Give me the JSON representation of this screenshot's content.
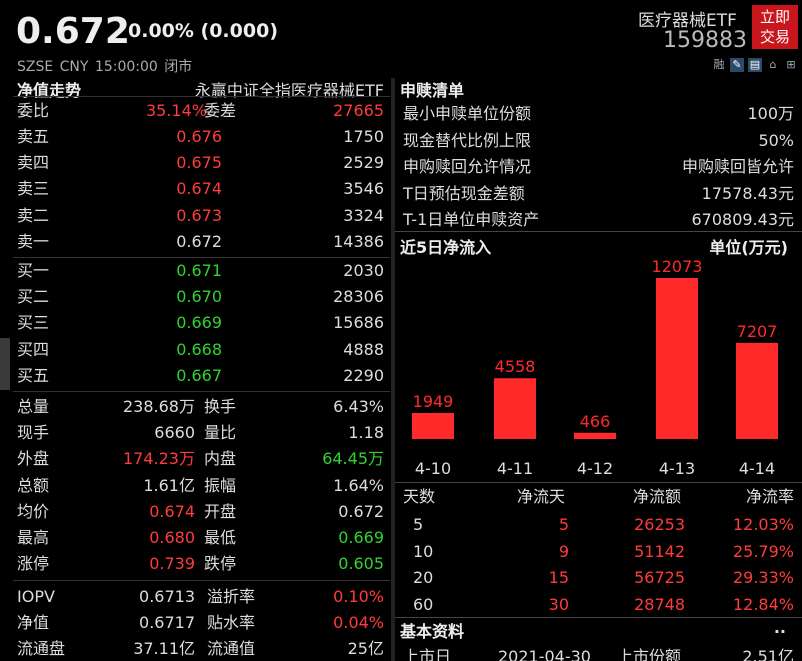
{
  "header": {
    "price": "0.672",
    "change": "0.00% (0.000)",
    "meta": "SZSE  CNY  15:00:00  闭市",
    "name": "医疗器械ETF",
    "code": "159883",
    "trade_button": "立即\n交易",
    "trade_line1": "立即",
    "trade_line2": "交易",
    "tool_icons": [
      "融",
      "pen-icon",
      "doc-icon",
      "home-icon",
      "plus-icon"
    ],
    "tool_label": "融"
  },
  "left": {
    "title": "净值走势",
    "fund_name": "永赢中证全指医疗器械ETF",
    "wei": {
      "label1": "委比",
      "val1": "35.14%",
      "label2": "委差",
      "val2": "27665"
    },
    "asks": [
      {
        "label": "卖五",
        "price": "0.676",
        "vol": "1750"
      },
      {
        "label": "卖四",
        "price": "0.675",
        "vol": "2529"
      },
      {
        "label": "卖三",
        "price": "0.674",
        "vol": "3546"
      },
      {
        "label": "卖二",
        "price": "0.673",
        "vol": "3324"
      },
      {
        "label": "卖一",
        "price": "0.672",
        "vol": "14386"
      }
    ],
    "bids": [
      {
        "label": "买一",
        "price": "0.671",
        "vol": "2030"
      },
      {
        "label": "买二",
        "price": "0.670",
        "vol": "28306"
      },
      {
        "label": "买三",
        "price": "0.669",
        "vol": "15686"
      },
      {
        "label": "买四",
        "price": "0.668",
        "vol": "4888"
      },
      {
        "label": "买五",
        "price": "0.667",
        "vol": "2290"
      }
    ],
    "stats": [
      {
        "l1": "总量",
        "v1": "238.68万",
        "c1": "wht",
        "l2": "换手",
        "v2": "6.43%",
        "c2": "wht"
      },
      {
        "l1": "现手",
        "v1": "6660",
        "c1": "wht",
        "l2": "量比",
        "v2": "1.18",
        "c2": "wht"
      },
      {
        "l1": "外盘",
        "v1": "174.23万",
        "c1": "red",
        "l2": "内盘",
        "v2": "64.45万",
        "c2": "grn"
      },
      {
        "l1": "总额",
        "v1": "1.61亿",
        "c1": "wht",
        "l2": "振幅",
        "v2": "1.64%",
        "c2": "wht"
      },
      {
        "l1": "均价",
        "v1": "0.674",
        "c1": "red",
        "l2": "开盘",
        "v2": "0.672",
        "c2": "wht"
      },
      {
        "l1": "最高",
        "v1": "0.680",
        "c1": "red",
        "l2": "最低",
        "v2": "0.669",
        "c2": "grn"
      },
      {
        "l1": "涨停",
        "v1": "0.739",
        "c1": "red",
        "l2": "跌停",
        "v2": "0.605",
        "c2": "grn"
      }
    ],
    "stats2": [
      {
        "l1": "IOPV",
        "v1": "0.6713",
        "c1": "wht",
        "l2": "溢折率",
        "v2": "0.10%",
        "c2": "red"
      },
      {
        "l1": "净值",
        "v1": "0.6717",
        "c1": "wht",
        "l2": "贴水率",
        "v2": "0.04%",
        "c2": "red"
      },
      {
        "l1": "流通盘",
        "v1": "37.11亿",
        "c1": "wht",
        "l2": "流通值",
        "v2": "25亿",
        "c2": "wht"
      }
    ]
  },
  "right": {
    "sub_title": "申赎清单",
    "sub_rows": [
      {
        "label": "最小申赎单位份额",
        "value": "100万"
      },
      {
        "label": "现金替代比例上限",
        "value": "50%"
      },
      {
        "label": "申购赎回允许情况",
        "value": "申购赎回皆允许"
      },
      {
        "label": "T日预估现金差额",
        "value": "17578.43元"
      },
      {
        "label": "T-1日单位申赎资产",
        "value": "670809.43元"
      }
    ],
    "flow_title": "近5日净流入",
    "flow_unit": "单位(万元)",
    "flow_headers": [
      "天数",
      "净流天",
      "净流额",
      "净流率"
    ],
    "flow_rows": [
      {
        "days": "5",
        "d": "5",
        "amt": "26253",
        "rate": "12.03%"
      },
      {
        "days": "10",
        "d": "9",
        "amt": "51142",
        "rate": "25.79%"
      },
      {
        "days": "20",
        "d": "15",
        "amt": "56725",
        "rate": "29.33%"
      },
      {
        "days": "60",
        "d": "30",
        "amt": "28748",
        "rate": "12.84%"
      }
    ],
    "basic_title": "基本资料",
    "basic_row": {
      "l1": "上市日",
      "v1": "2021-04-30",
      "l2": "上市份额",
      "v2": "2.51亿"
    },
    "colors": {
      "bar": "#ff2a2a",
      "accent": "#c8161d"
    }
  },
  "chart_data": {
    "type": "bar",
    "title": "近5日净流入",
    "ylabel": "单位(万元)",
    "categories": [
      "4-10",
      "4-11",
      "4-12",
      "4-13",
      "4-14"
    ],
    "values": [
      1949,
      4558,
      466,
      12073,
      7207
    ],
    "ylim": [
      0,
      12073
    ],
    "grid": false
  }
}
